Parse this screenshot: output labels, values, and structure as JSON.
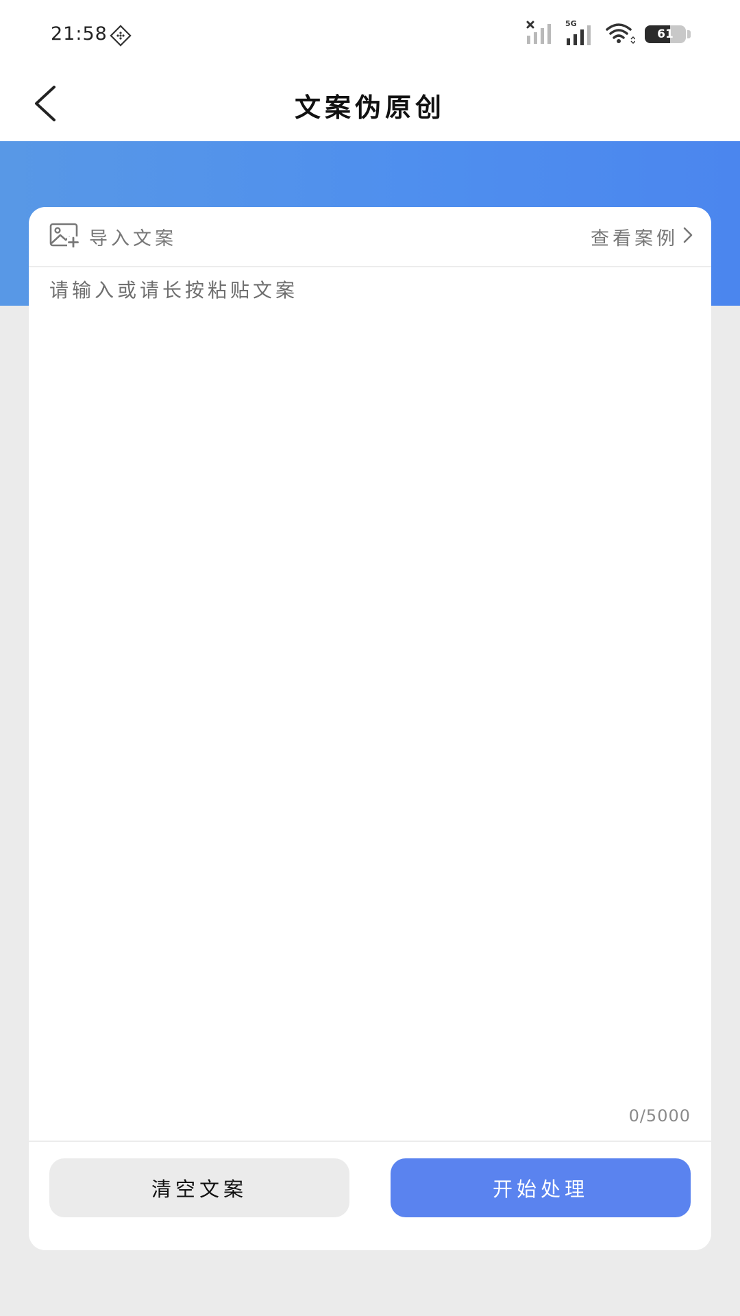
{
  "status_bar": {
    "time": "21:58",
    "network_label": "5G",
    "battery_level": "61"
  },
  "nav": {
    "title": "文案伪原创"
  },
  "card": {
    "import_label": "导入文案",
    "examples_label": "查看案例",
    "input_placeholder": "请输入或请长按粘贴文案",
    "input_value": "",
    "char_count": "0/5000"
  },
  "actions": {
    "clear_label": "清空文案",
    "start_label": "开始处理"
  },
  "colors": {
    "accent": "#5a83ef",
    "header_band": "#4f8fee",
    "page_background": "#ebebeb"
  },
  "icons": {
    "back": "chevron-left-icon",
    "import": "image-add-icon",
    "examples": "chevron-right-icon"
  }
}
